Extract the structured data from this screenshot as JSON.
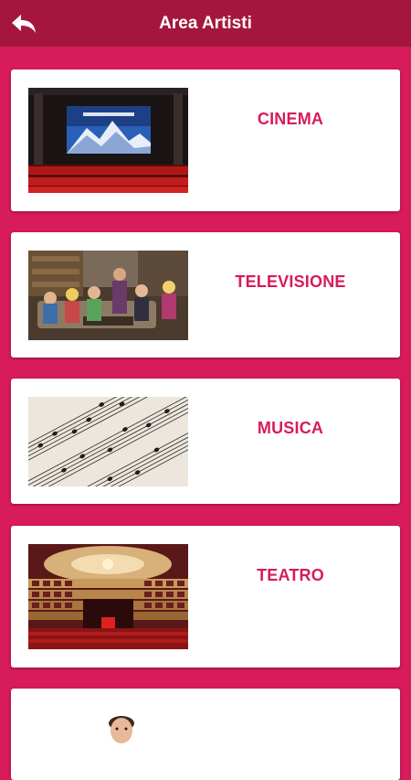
{
  "header": {
    "title": "Area Artisti",
    "back_icon": "back-arrow-icon"
  },
  "colors": {
    "background": "#d81b5a",
    "app_bar": "#a5163e",
    "label": "#d81b5a",
    "card": "#ffffff"
  },
  "categories": [
    {
      "label": "CINEMA",
      "image": "cinema-theater-image"
    },
    {
      "label": "TELEVISIONE",
      "image": "tv-show-cast-image"
    },
    {
      "label": "MUSICA",
      "image": "sheet-music-image"
    },
    {
      "label": "TEATRO",
      "image": "opera-house-image"
    },
    {
      "label": "",
      "image": "actor-portrait-image"
    }
  ]
}
